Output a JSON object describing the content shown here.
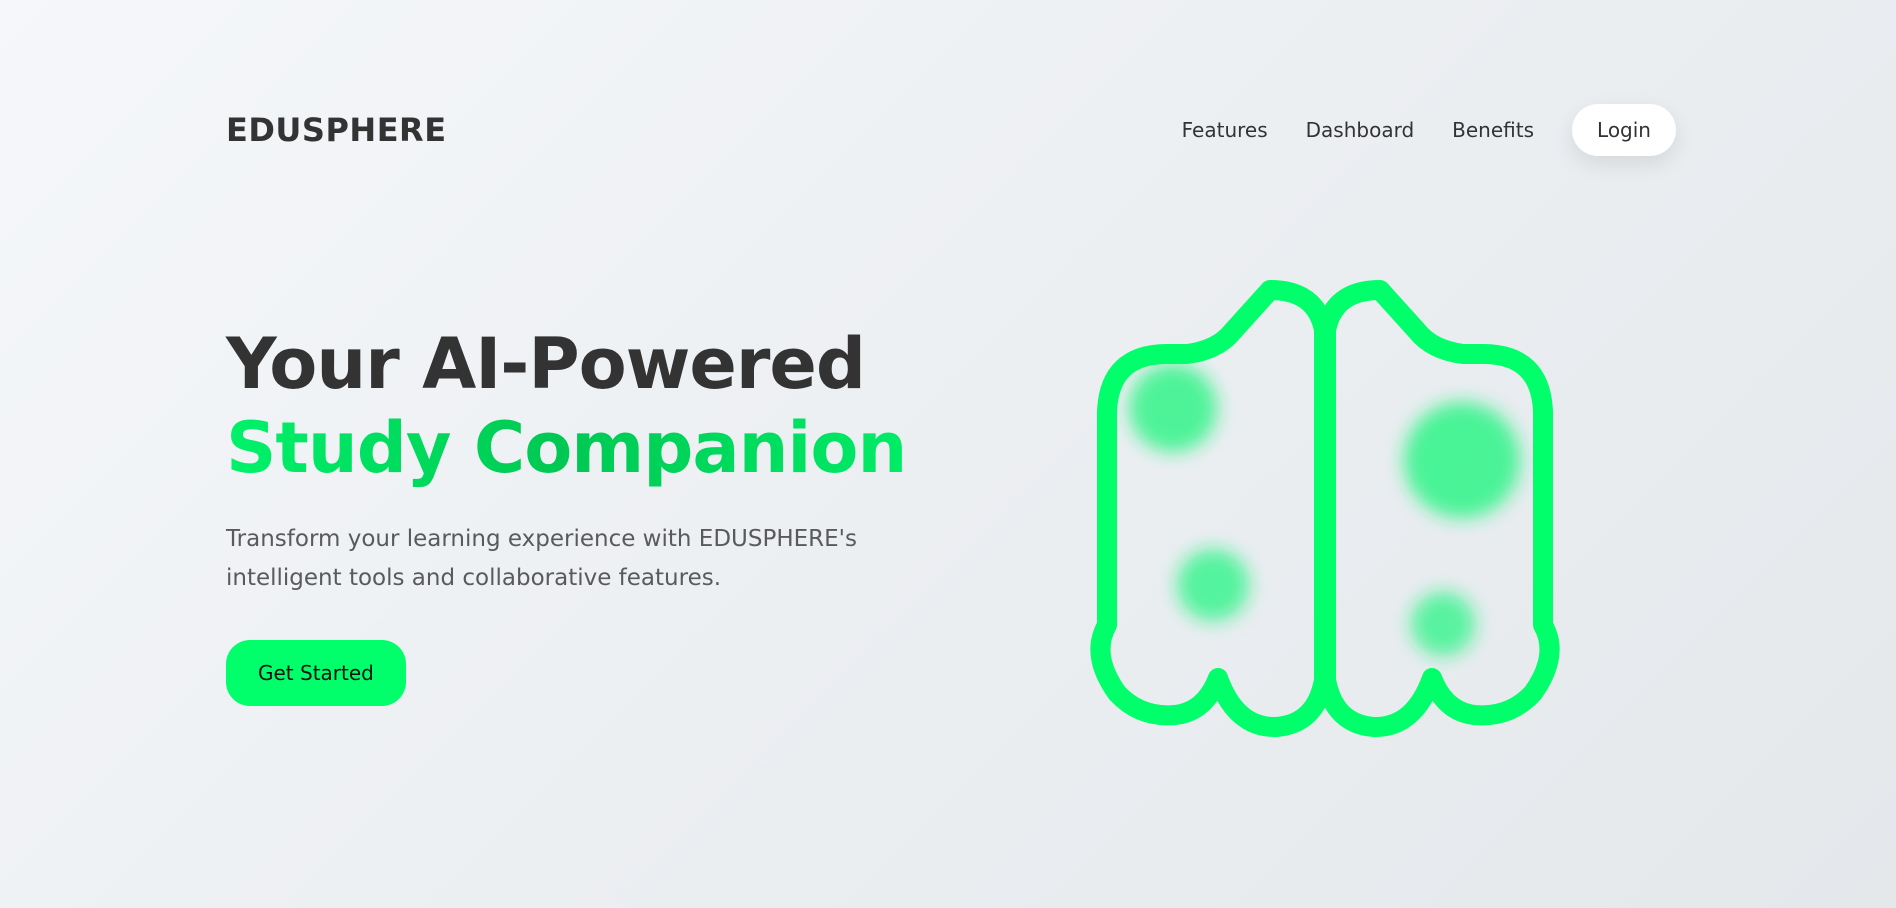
{
  "brand": {
    "name": "EDUSPHERE"
  },
  "nav": {
    "links": [
      "Features",
      "Dashboard",
      "Benefits"
    ],
    "login_label": "Login"
  },
  "hero": {
    "title_line1": "Your AI-Powered",
    "title_line2": "Study Companion",
    "subtitle": "Transform your learning experience with EDUSPHERE's intelligent tools and collaborative features.",
    "cta_label": "Get Started"
  },
  "illustration": {
    "icon": "brain-icon"
  },
  "colors": {
    "accent": "#00ff6a",
    "text_dark": "#333333",
    "text_muted": "#5a5a5a",
    "background": "#eceff2"
  }
}
